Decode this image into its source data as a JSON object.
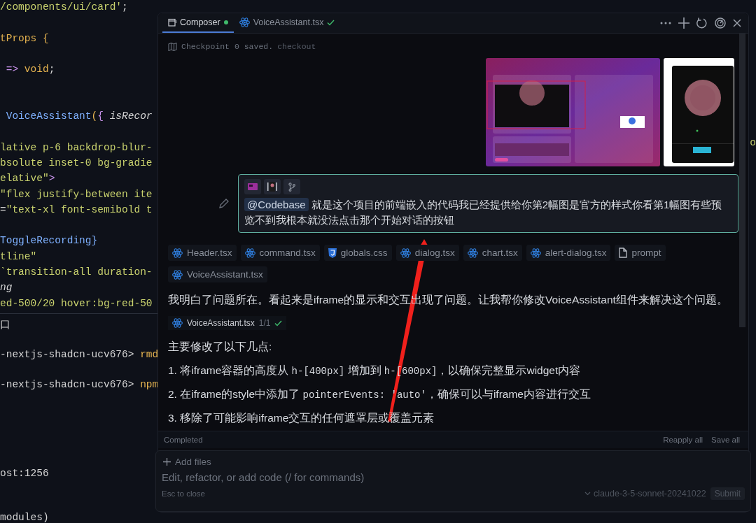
{
  "editor": {
    "code_lines": [
      {
        "kind": "code",
        "tokens": [
          {
            "kind": "string",
            "text": "/components/ui/card'"
          },
          {
            "kind": "plain",
            "text": ";"
          }
        ]
      },
      {
        "kind": "blank"
      },
      {
        "kind": "code",
        "tokens": [
          {
            "kind": "type",
            "text": "tProps "
          },
          {
            "kind": "type",
            "text": "{"
          }
        ]
      },
      {
        "kind": "blank"
      },
      {
        "kind": "code",
        "tokens": [
          {
            "kind": "op",
            "text": " => "
          },
          {
            "kind": "type",
            "text": "void"
          },
          {
            "kind": "plain",
            "text": ";"
          }
        ]
      },
      {
        "kind": "blank"
      },
      {
        "kind": "blank"
      },
      {
        "kind": "code",
        "tokens": [
          {
            "kind": "func",
            "text": " VoiceAssistant"
          },
          {
            "kind": "type",
            "text": "("
          },
          {
            "kind": "op",
            "text": "{ "
          },
          {
            "kind": "param",
            "text": "isRecor"
          }
        ]
      },
      {
        "kind": "blank"
      },
      {
        "kind": "code",
        "tokens": [
          {
            "kind": "string",
            "text": "lative p-6 backdrop-blur-"
          }
        ]
      },
      {
        "kind": "code",
        "tokens": [
          {
            "kind": "string",
            "text": "bsolute inset-0 bg-gradie"
          }
        ]
      },
      {
        "kind": "code",
        "tokens": [
          {
            "kind": "string",
            "text": "elative\""
          },
          {
            "kind": "op",
            "text": ">"
          }
        ]
      },
      {
        "kind": "code",
        "tokens": [
          {
            "kind": "string",
            "text": "\"flex justify-between ite"
          }
        ]
      },
      {
        "kind": "code",
        "tokens": [
          {
            "kind": "plain",
            "text": "="
          },
          {
            "kind": "string",
            "text": "\"text-xl font-semibold t"
          }
        ]
      },
      {
        "kind": "blank"
      },
      {
        "kind": "code",
        "tokens": [
          {
            "kind": "func",
            "text": "ToggleRecording}"
          }
        ]
      },
      {
        "kind": "code",
        "tokens": [
          {
            "kind": "string",
            "text": "tline\""
          }
        ]
      },
      {
        "kind": "code",
        "tokens": [
          {
            "kind": "string",
            "text": "`transition-all duration-"
          }
        ]
      },
      {
        "kind": "code",
        "tokens": [
          {
            "kind": "param",
            "text": "ng"
          }
        ]
      },
      {
        "kind": "code",
        "tokens": [
          {
            "kind": "string",
            "text": "ed-500/20 hover:bg-red-50"
          }
        ]
      }
    ],
    "terminal_lines": [
      {
        "kind": "code",
        "tokens": [
          {
            "kind": "plain",
            "text": "口"
          }
        ]
      },
      {
        "kind": "blank"
      },
      {
        "kind": "code",
        "tokens": [
          {
            "kind": "plain",
            "text": "-nextjs-shadcn-ucv676> "
          },
          {
            "kind": "type",
            "text": "rmd"
          }
        ]
      },
      {
        "kind": "blank"
      },
      {
        "kind": "code",
        "tokens": [
          {
            "kind": "plain",
            "text": "-nextjs-shadcn-ucv676> "
          },
          {
            "kind": "type",
            "text": "npm"
          }
        ]
      },
      {
        "kind": "blank"
      },
      {
        "kind": "blank"
      },
      {
        "kind": "blank"
      },
      {
        "kind": "blank"
      },
      {
        "kind": "blank"
      },
      {
        "kind": "code",
        "tokens": [
          {
            "kind": "plain",
            "text": "ost:1256"
          }
        ]
      },
      {
        "kind": "blank"
      },
      {
        "kind": "blank"
      },
      {
        "kind": "code",
        "tokens": [
          {
            "kind": "plain",
            "text": "modules)"
          }
        ]
      }
    ],
    "edge_fragment": "o"
  },
  "composer": {
    "tabs": [
      {
        "label": "Composer",
        "selected": true
      },
      {
        "label": "VoiceAssistant.tsx",
        "selected": false
      }
    ],
    "checkpoint": {
      "text": "Checkpoint 0 saved.",
      "link": "checkout"
    },
    "message": {
      "context_buttons": [
        {
          "kind": "app-thumb"
        },
        {
          "kind": "card-thumb"
        },
        {
          "kind": "branch"
        }
      ],
      "mention": "@Codebase",
      "text": "就是这个项目的前端嵌入的代码我已经提供给你第2幅图是官方的样式你看第1幅图有些预览不到我根本就没法点击那个开始对话的按钮"
    },
    "context_files": [
      {
        "name": "Header.tsx",
        "kind": "react"
      },
      {
        "name": "command.tsx",
        "kind": "react"
      },
      {
        "name": "globals.css",
        "kind": "css"
      },
      {
        "name": "dialog.tsx",
        "kind": "react"
      },
      {
        "name": "chart.tsx",
        "kind": "react"
      },
      {
        "name": "alert-dialog.tsx",
        "kind": "react"
      },
      {
        "name": "prompt",
        "kind": "file"
      },
      {
        "name": "VoiceAssistant.tsx",
        "kind": "react"
      }
    ],
    "reply": {
      "intro": "我明白了问题所在。看起来是iframe的显示和交互出现了问题。让我帮你修改VoiceAssistant组件来解决这个问题。",
      "edited_file": {
        "name": "VoiceAssistant.tsx",
        "count": "1/1",
        "applied": true
      },
      "summary": "主要修改了以下几点:",
      "points": [
        [
          {
            "kind": "text",
            "text": "1. 将iframe容器的高度从 "
          },
          {
            "kind": "code",
            "text": "h-[400px]"
          },
          {
            "kind": "text",
            "text": " 增加到 "
          },
          {
            "kind": "code",
            "text": "h-[600px]"
          },
          {
            "kind": "text",
            "text": "，以确保完整显示widget内容"
          }
        ],
        [
          {
            "kind": "text",
            "text": "2. 在iframe的style中添加了 "
          },
          {
            "kind": "code",
            "text": "pointerEvents: 'auto'"
          },
          {
            "kind": "text",
            "text": "，确保可以与iframe内容进行交互"
          }
        ],
        [
          {
            "kind": "text",
            "text": "3. 移除了可能影响iframe交互的任何遮罩层或覆盖元素"
          }
        ]
      ]
    },
    "footer": {
      "status": "Completed",
      "actions": [
        "Reapply all",
        "Save all"
      ]
    },
    "input": {
      "add_files": "Add files",
      "placeholder": "Edit, refactor, or add code (/ for commands)",
      "hint": "Esc to close",
      "model": "claude-3-5-sonnet-20241022",
      "submit": "Submit"
    }
  }
}
